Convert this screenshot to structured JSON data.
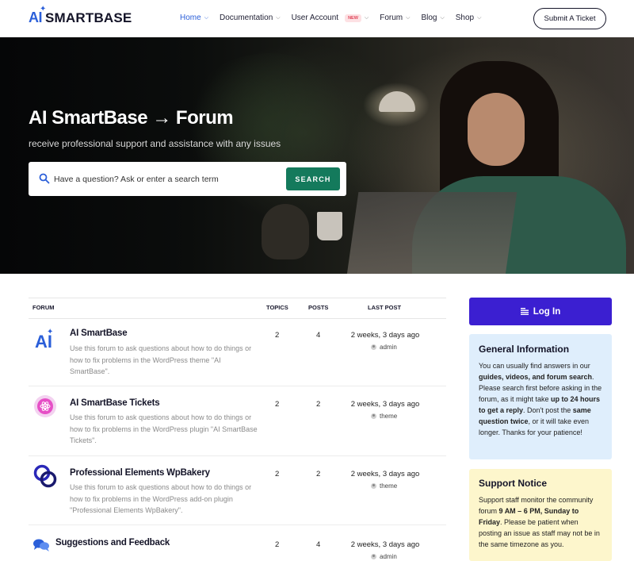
{
  "header": {
    "logo_ai": "AI",
    "logo_text": "SMARTBASE",
    "nav": [
      {
        "label": "Home",
        "active": true
      },
      {
        "label": "Documentation"
      },
      {
        "label": "User Account",
        "badge": "NEW"
      },
      {
        "label": "Forum"
      },
      {
        "label": "Blog"
      },
      {
        "label": "Shop"
      }
    ],
    "submit_label": "Submit A Ticket"
  },
  "hero": {
    "title": "AI SmartBase → Forum",
    "subtitle": "receive professional support and assistance with any issues",
    "search_placeholder": "Have a question? Ask or enter a search term",
    "search_button": "SEARCH"
  },
  "forum_table": {
    "headers": {
      "forum": "FORUM",
      "topics": "TOPICS",
      "posts": "POSTS",
      "last_post": "LAST POST"
    },
    "rows": [
      {
        "icon": "ai-logo-icon",
        "title": "AI SmartBase",
        "desc": "Use this forum to ask questions about how to do things or how to fix problems in the WordPress theme \"AI SmartBase\".",
        "topics": "2",
        "posts": "4",
        "last_post": "2 weeks, 3 days ago",
        "author": "admin"
      },
      {
        "icon": "tickets-icon",
        "title": "AI SmartBase Tickets",
        "desc": "Use this forum to ask questions about how to do things or how to fix problems in the WordPress plugin \"AI SmartBase Tickets\".",
        "topics": "2",
        "posts": "2",
        "last_post": "2 weeks, 3 days ago",
        "author": "theme"
      },
      {
        "icon": "linked-rings-icon",
        "title": "Professional Elements WpBakery",
        "desc": "Use this forum to ask questions about how to do things or how to fix problems in the WordPress add-on plugin \"Professional Elements WpBakery\".",
        "topics": "2",
        "posts": "2",
        "last_post": "2 weeks, 3 days ago",
        "author": "theme"
      },
      {
        "icon": "chat-bubbles-icon",
        "title": "Suggestions and Feedback",
        "desc": "",
        "topics": "2",
        "posts": "4",
        "last_post": "2 weeks, 3 days ago",
        "author": "admin"
      }
    ]
  },
  "sidebar": {
    "login_label": "Log In",
    "info": {
      "title": "General Information",
      "t1": "You can usually find answers in our ",
      "b1": "guides, videos, and forum search",
      "t2": ". Please search first before asking in the forum, as it might take ",
      "b2": "up to 24 hours to get a reply",
      "t3": ". Don't post the ",
      "b3": "same question twice",
      "t4": ", or it will take even longer. Thanks for your patience!"
    },
    "notice": {
      "title": "Support Notice",
      "t1": "Support staff monitor the community forum ",
      "b1": "9 AM – 6 PM, Sunday to Friday",
      "t2": ". Please be patient when posting an issue as staff may not be in the same timezone as you."
    }
  },
  "colors": {
    "brand_blue": "#2b5fd9",
    "search_green": "#147a5c",
    "login_purple": "#3b1fd1",
    "info_bg": "#dfeefc",
    "notice_bg": "#fdf6cc"
  }
}
